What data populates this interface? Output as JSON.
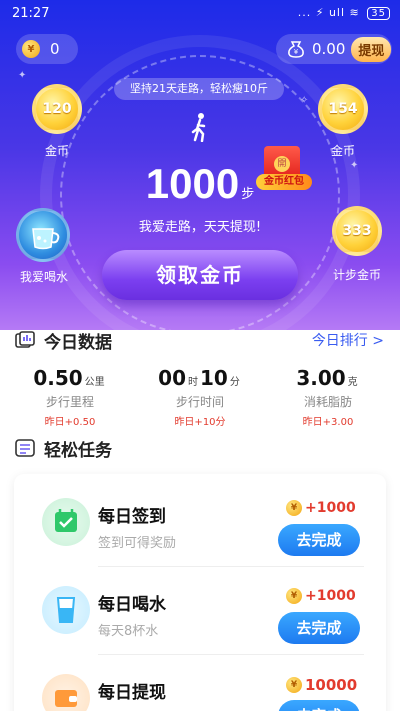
{
  "status_bar": {
    "time": "21:27",
    "icons": "... ⚡ ull ≋",
    "battery": "35"
  },
  "header": {
    "coins": "0",
    "cash": "0.00",
    "withdraw_label": "提现"
  },
  "tip": "坚持21天走路，轻松瘦10斤",
  "bubbles": {
    "top_left": {
      "value": "120",
      "label": "金币"
    },
    "top_right": {
      "value": "154",
      "label": "金币"
    },
    "mid_right": {
      "value": "333",
      "label": "计步金币"
    },
    "drink_label": "我爱喝水"
  },
  "steps": {
    "count": "1000",
    "unit": "步"
  },
  "slogan": "我爱走路，天天提现!",
  "red_packet": {
    "seal": "開",
    "tag": "金币红包"
  },
  "claim_button": "领取金币",
  "today": {
    "title": "今日数据",
    "rank_link": "今日排行 >",
    "stats": [
      {
        "value": "0.50",
        "unit": "公里",
        "label": "步行里程",
        "delta": "昨日+0.50"
      },
      {
        "value_a": "00",
        "unit_a": "时",
        "value_b": "10",
        "unit_b": "分",
        "label": "步行时间",
        "delta": "昨日+10分"
      },
      {
        "value": "3.00",
        "unit": "克",
        "label": "消耗脂肪",
        "delta": "昨日+3.00"
      }
    ]
  },
  "tasks": {
    "title": "轻松任务",
    "items": [
      {
        "title": "每日签到",
        "desc": "签到可得奖励",
        "reward": "+1000",
        "action": "去完成",
        "color": "#2fc86a"
      },
      {
        "title": "每日喝水",
        "desc": "每天8杯水",
        "reward": "+1000",
        "action": "去完成",
        "color": "#39b6f5"
      },
      {
        "title": "每日提现",
        "desc": "",
        "reward": "10000",
        "action": "去完成",
        "color": "#ff9a3a"
      }
    ]
  }
}
